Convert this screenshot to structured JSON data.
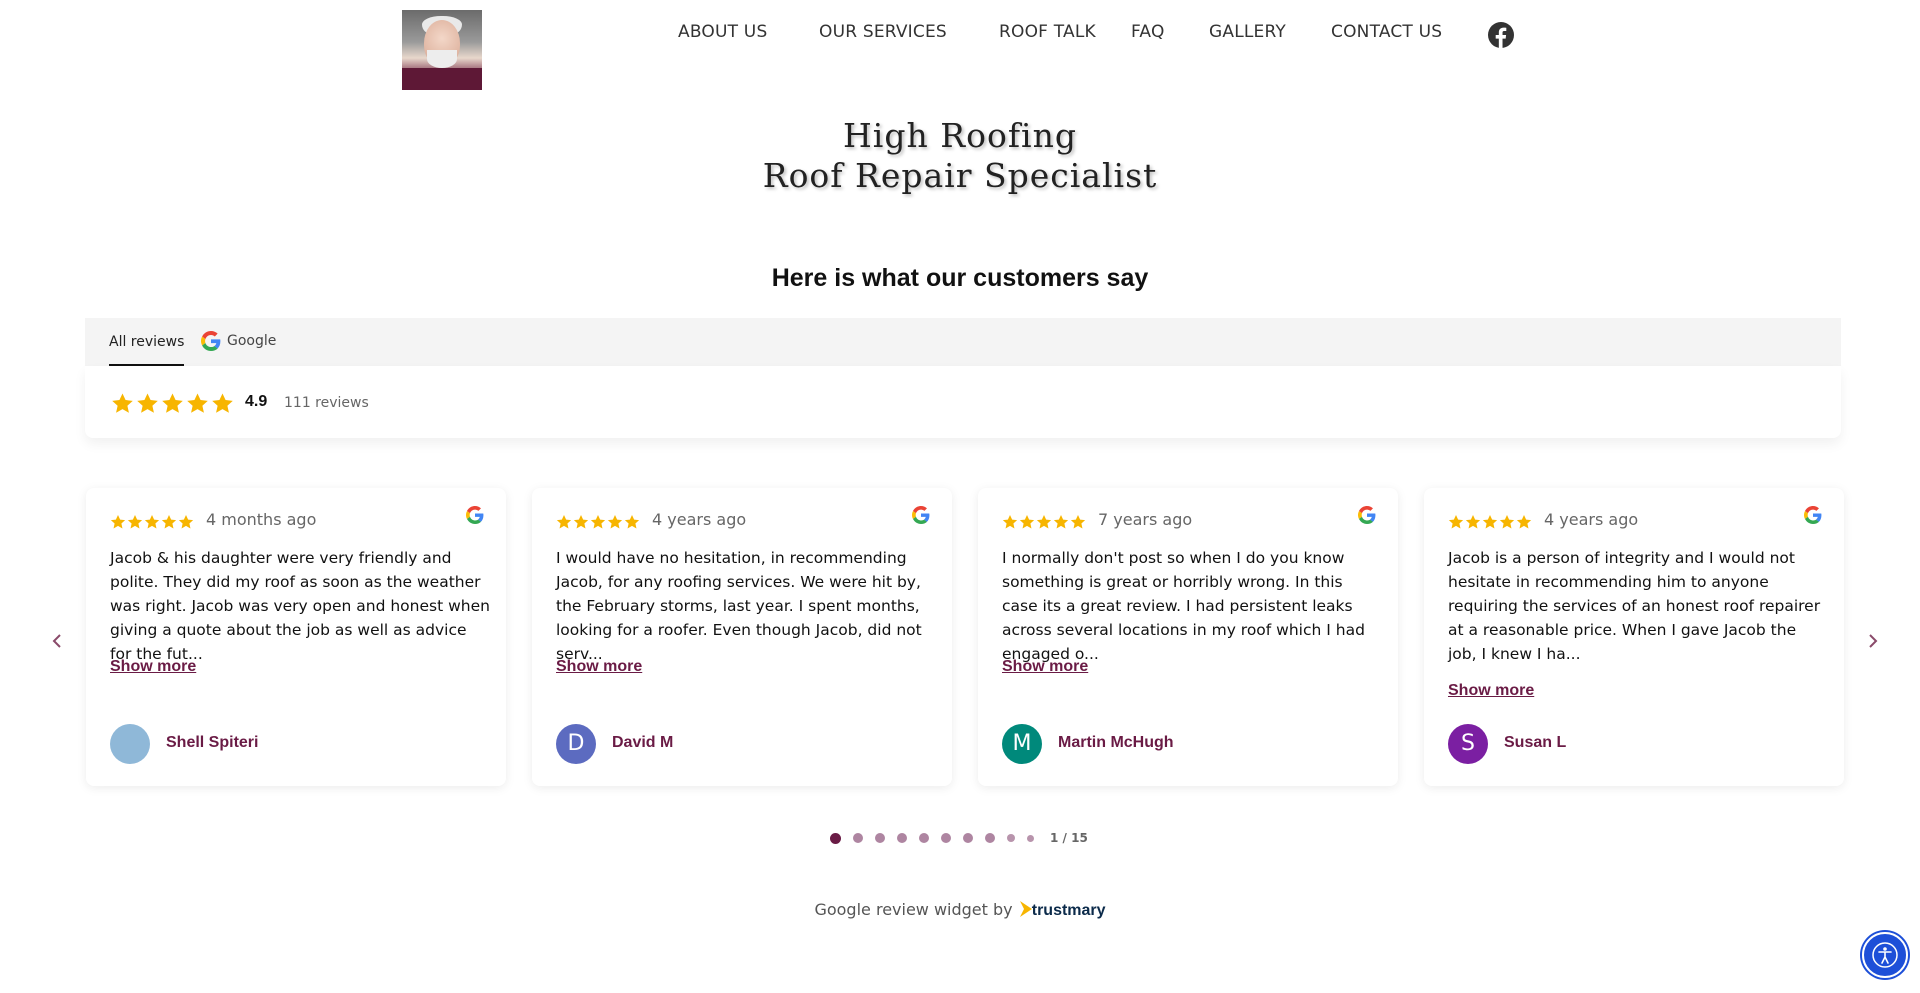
{
  "nav": {
    "items": [
      "ABOUT US",
      "OUR SERVICES",
      "ROOF TALK",
      "FAQ",
      "GALLERY",
      "CONTACT US"
    ]
  },
  "site": {
    "title_line1": "High Roofing",
    "title_line2": "Roof Repair Specialist"
  },
  "reviews_section": {
    "heading": "Here is what our customers say",
    "tabs": [
      "All reviews",
      "Google"
    ],
    "rating": "4.9",
    "review_count": "111 reviews",
    "star_color": "#f7b500"
  },
  "cards": [
    {
      "stars": 5,
      "time": "4 months ago",
      "text": "Jacob & his daughter were very friendly and polite. They did my roof as soon as the weather was right. Jacob was very open and honest when giving a quote about the job as well as advice for the fut...",
      "show_more": "Show more",
      "author": "Shell Spiteri",
      "avatar_initial": "",
      "avatar_color": "#8fb8d8"
    },
    {
      "stars": 5,
      "time": "4 years ago",
      "text": "I would have no hesitation, in recommending Jacob, for any roofing services. We were hit by, the February storms, last year. I spent months, looking for a roofer. Even though Jacob, did not serv...",
      "show_more": "Show more",
      "author": "David M",
      "avatar_initial": "D",
      "avatar_color": "#5c6bc0"
    },
    {
      "stars": 5,
      "time": "7 years ago",
      "text": "I normally don't post so when I do you know something is great or horribly wrong. In this case its a great review. I had persistent leaks across several locations in my roof which I had engaged o...",
      "show_more": "Show more",
      "author": "Martin McHugh",
      "avatar_initial": "M",
      "avatar_color": "#00897b"
    },
    {
      "stars": 5,
      "time": "4 years ago",
      "text": "Jacob is a person of integrity and I would not hesitate in recommending him to anyone requiring the services of an honest roof repairer at a reasonable price. When I gave Jacob the job, I knew I ha...",
      "show_more": "Show more",
      "author": "Susan L",
      "avatar_initial": "S",
      "avatar_color": "#7b1fa2"
    }
  ],
  "pager": {
    "label": "1 / 15",
    "active_color": "#6a1b45",
    "dot_color": "#a07090"
  },
  "credit": {
    "prefix": "Google review widget by",
    "brand": "trustmary"
  },
  "icons": {
    "facebook": "facebook-icon",
    "google": "google-icon",
    "prev": "chevron-left-icon",
    "next": "chevron-right-icon",
    "accessibility": "accessibility-icon"
  }
}
